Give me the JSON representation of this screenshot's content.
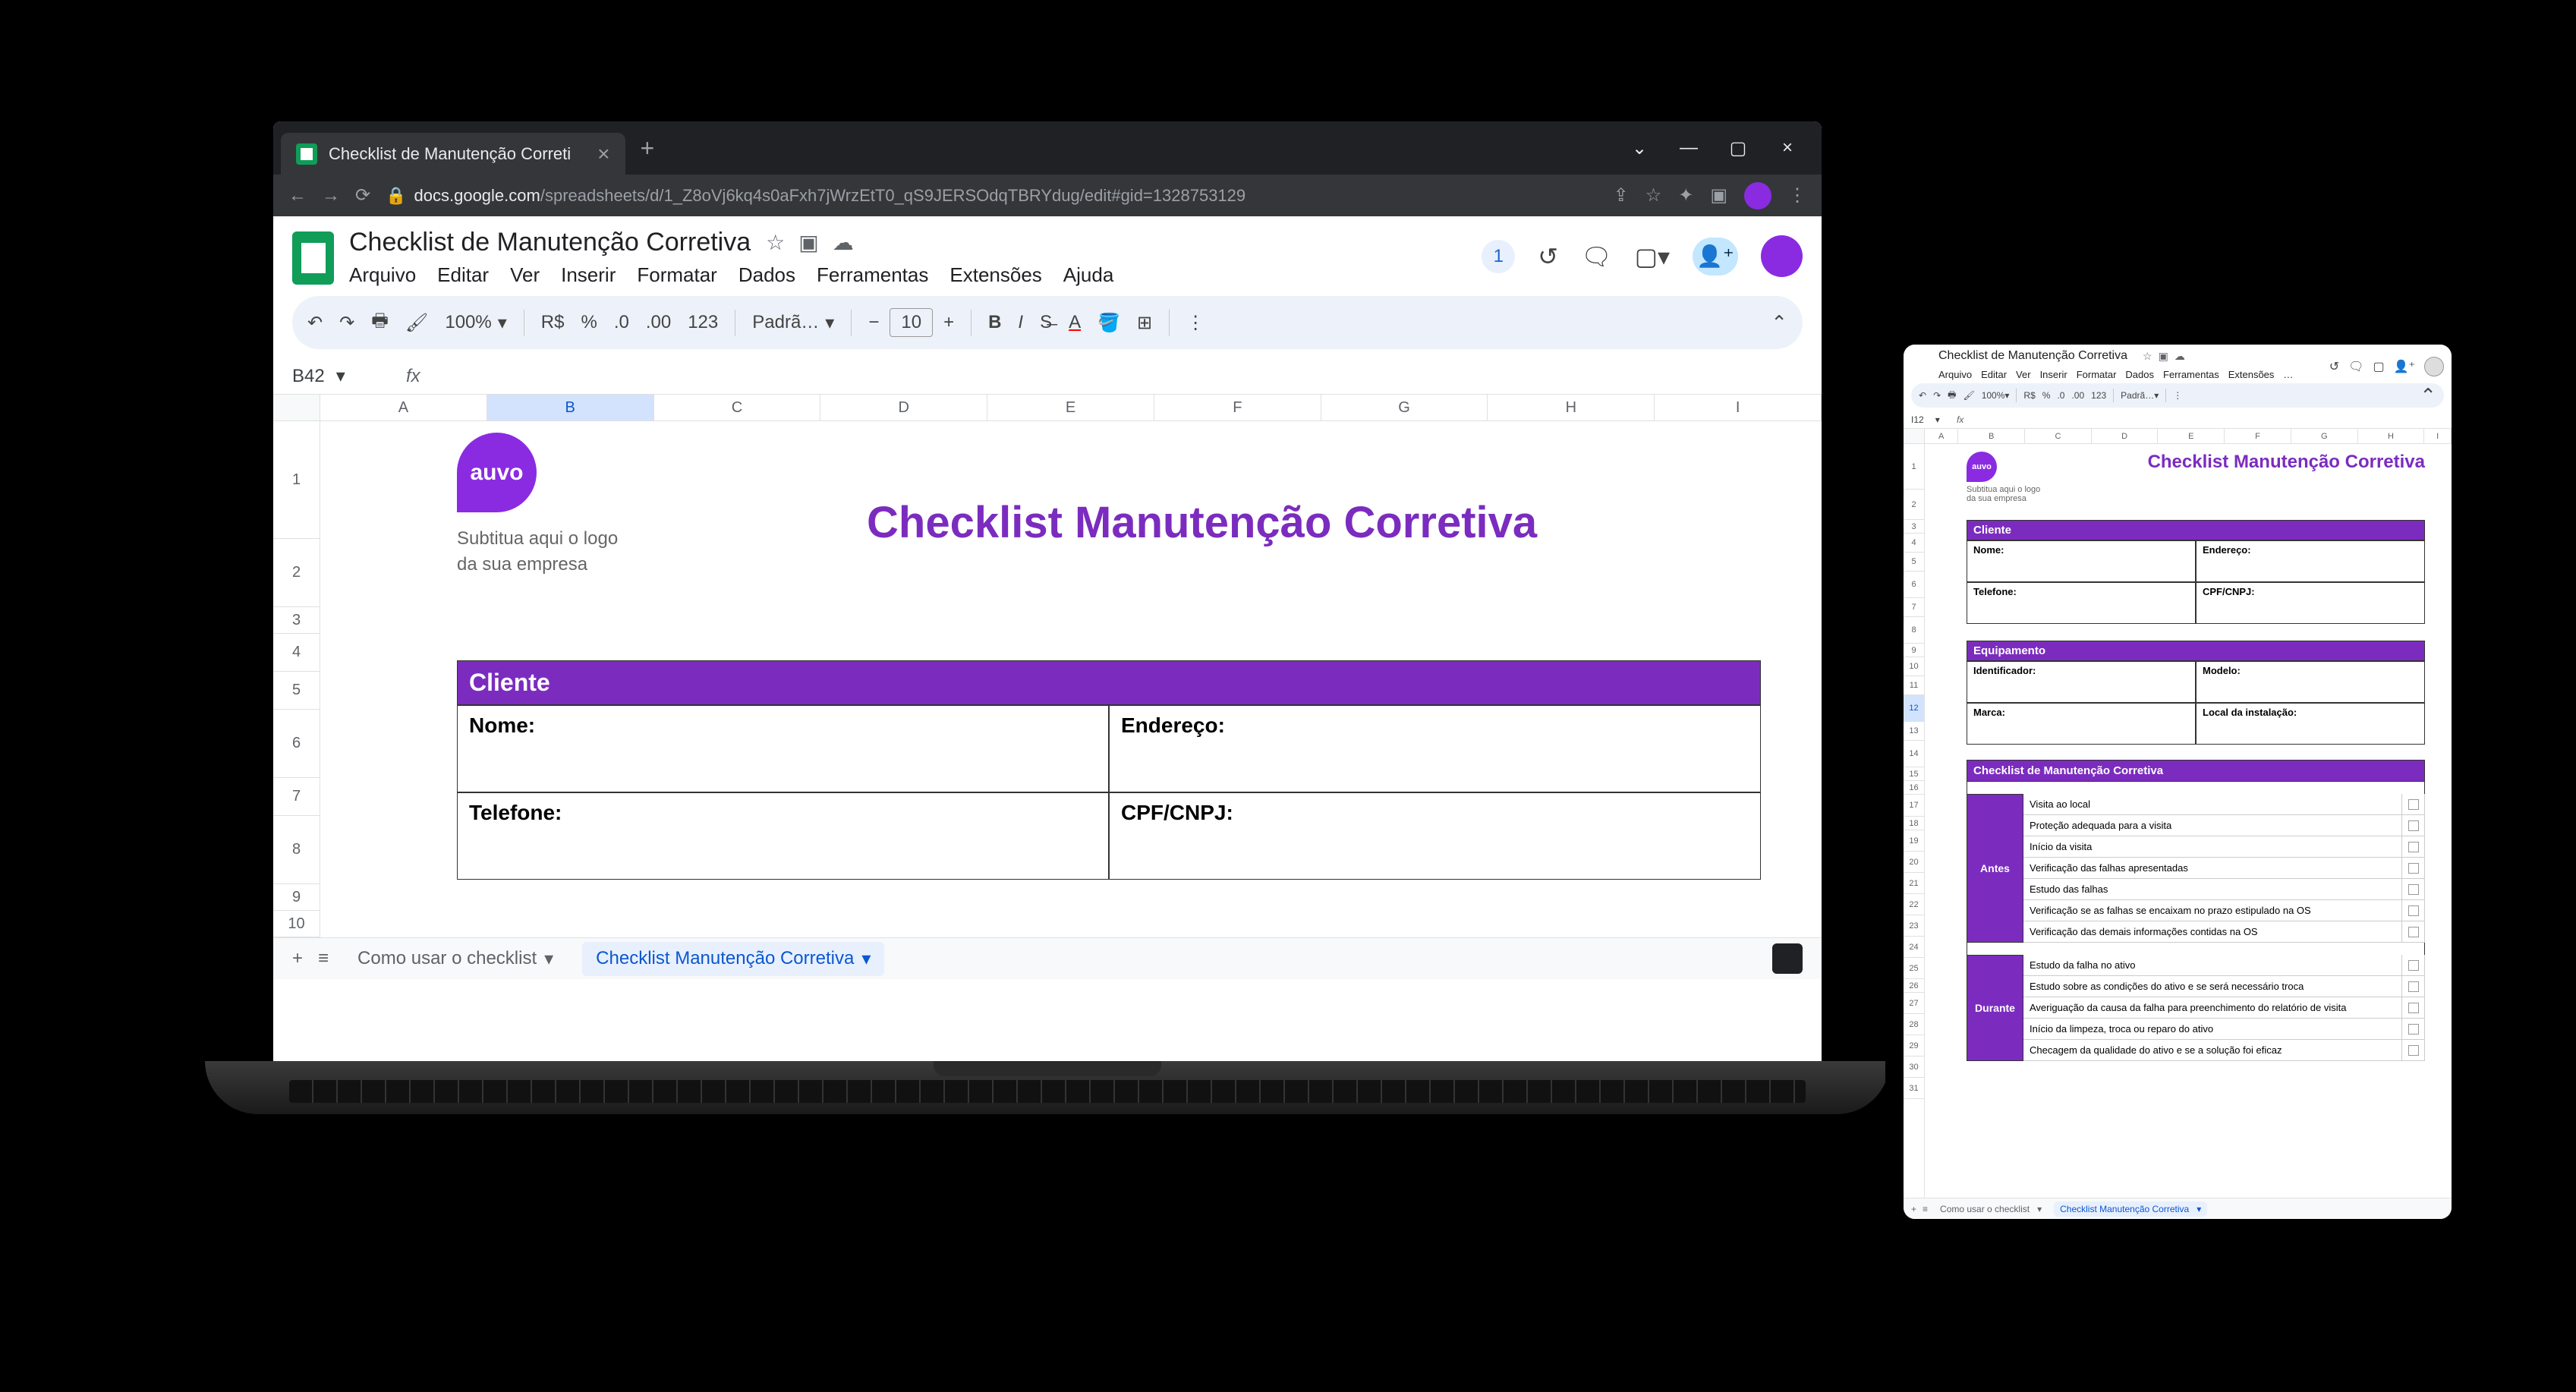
{
  "browser": {
    "tab_title": "Checklist de Manutenção Correti",
    "url_prefix": "docs.google.com",
    "url_path": "/spreadsheets/d/1_Z8oVj6kq4s0aFxh7jWrzEtT0_qS9JERSOdqTBRYdug/edit#gid=1328753129"
  },
  "doc_title": "Checklist de Manutenção Corretiva",
  "menus": [
    "Arquivo",
    "Editar",
    "Ver",
    "Inserir",
    "Formatar",
    "Dados",
    "Ferramentas",
    "Extensões",
    "Ajuda"
  ],
  "anon_count": "1",
  "toolbar": {
    "zoom": "100%",
    "currency": "R$",
    "percent": "%",
    "dec_dec": ".0",
    "dec_inc": ".00",
    "num_123": "123",
    "font": "Padrã…",
    "minus": "−",
    "font_size": "10",
    "plus": "+"
  },
  "cell_ref": "B42",
  "columns": [
    "A",
    "B",
    "C",
    "D",
    "E",
    "F",
    "G",
    "H",
    "I"
  ],
  "rows": [
    "1",
    "2",
    "3",
    "4",
    "5",
    "6",
    "7",
    "8",
    "9",
    "10"
  ],
  "content": {
    "brand": "auvo",
    "logo_sub": "Subtitua aqui o logo\nda sua empresa",
    "title": "Checklist Manutenção Corretiva",
    "cliente": {
      "header": "Cliente",
      "nome": "Nome:",
      "endereco": "Endereço:",
      "telefone": "Telefone:",
      "cpf": "CPF/CNPJ:"
    }
  },
  "sheet_tabs": {
    "tab1": "Como usar o checklist",
    "tab2": "Checklist Manutenção Corretiva"
  },
  "tablet": {
    "cell_ref": "I12",
    "columns": [
      "A",
      "B",
      "C",
      "D",
      "E",
      "F",
      "G",
      "H",
      "I"
    ],
    "rows": [
      "1",
      "2",
      "3",
      "4",
      "5",
      "6",
      "7",
      "8",
      "9",
      "10",
      "11",
      "12",
      "13",
      "14",
      "15",
      "16",
      "17",
      "18",
      "19",
      "20",
      "21",
      "22",
      "23",
      "24",
      "25",
      "26",
      "27",
      "28",
      "29",
      "30",
      "31"
    ],
    "equipamento": {
      "header": "Equipamento",
      "identificador": "Identificador:",
      "modelo": "Modelo:",
      "marca": "Marca:",
      "local": "Local da instalação:"
    },
    "checklist_header": "Checklist de Manutenção Corretiva",
    "antes": {
      "label": "Antes",
      "items": [
        "Visita ao local",
        "Proteção adequada para a visita",
        "Início da visita",
        "Verificação das falhas apresentadas",
        "Estudo das falhas",
        "Verificação se as falhas se encaixam no prazo estipulado na OS",
        "Verificação das demais informações contidas na OS"
      ]
    },
    "durante": {
      "label": "Durante",
      "items": [
        "Estudo da falha no ativo",
        "Estudo sobre as condições do ativo e se será necessário troca",
        "Averiguação da causa da falha para preenchimento do relatório de visita",
        "Início da limpeza, troca ou reparo do ativo",
        "Checagem da qualidade do ativo e se a solução foi eficaz"
      ]
    }
  }
}
